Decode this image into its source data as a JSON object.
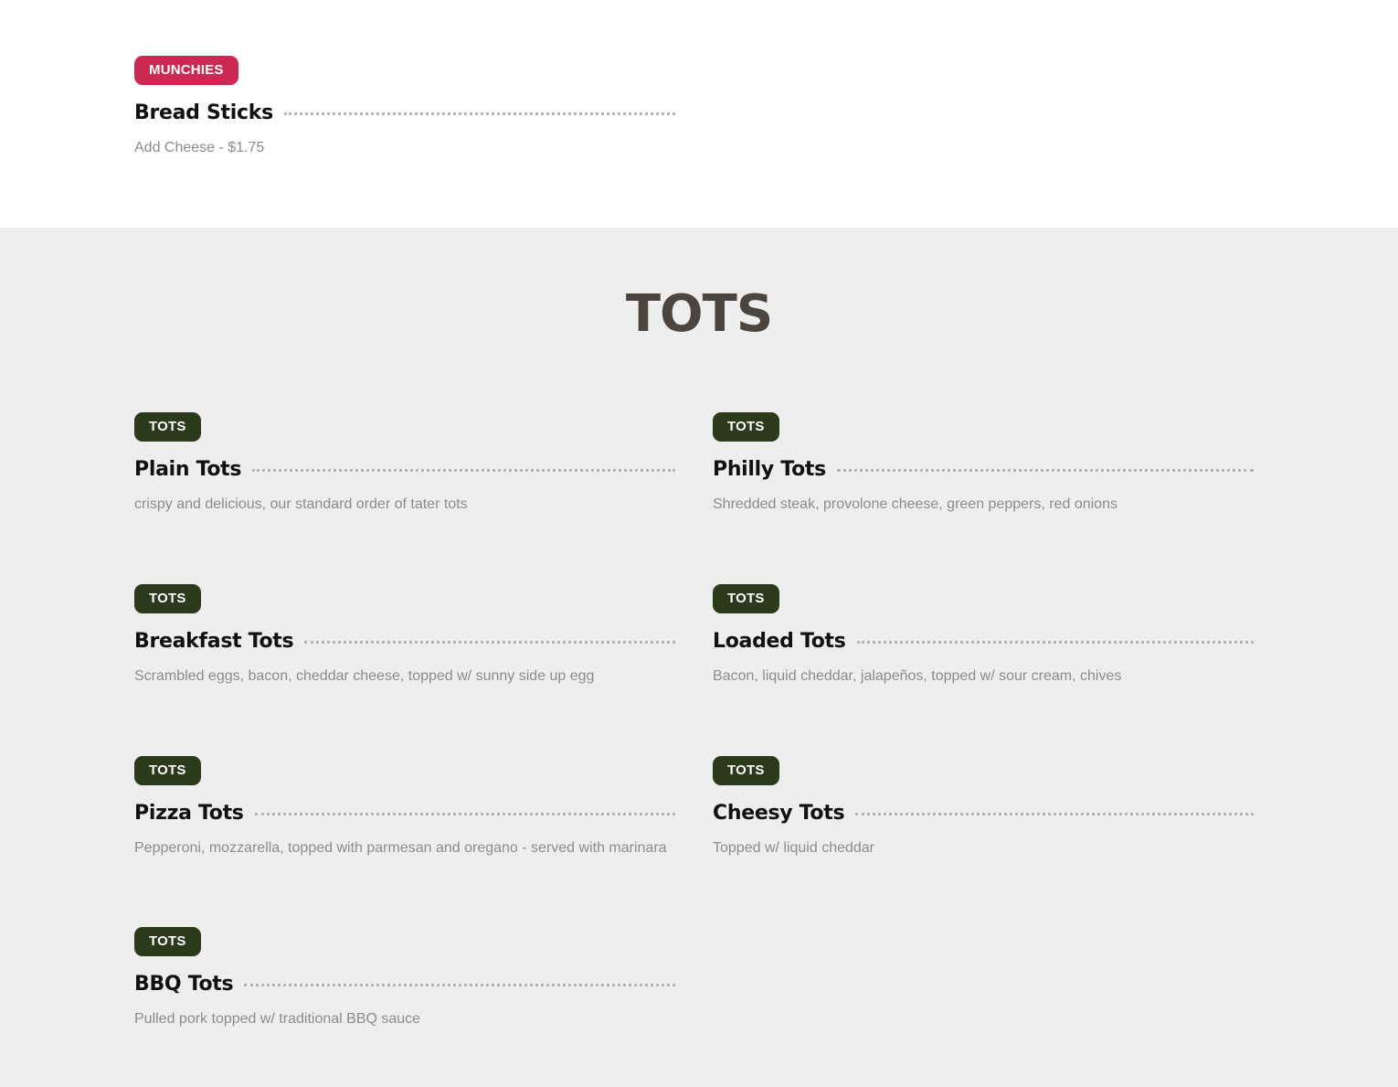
{
  "munchies": {
    "badge": "MUNCHIES",
    "title": "Bread Sticks",
    "desc": "Add Cheese - $1.75"
  },
  "tots": {
    "heading": "TOTS",
    "items": [
      {
        "badge": "TOTS",
        "title": "Plain Tots",
        "desc": "crispy and delicious, our standard order of tater tots"
      },
      {
        "badge": "TOTS",
        "title": "Philly Tots",
        "desc": "Shredded steak, provolone cheese, green peppers, red onions"
      },
      {
        "badge": "TOTS",
        "title": "Breakfast Tots",
        "desc": "Scrambled eggs, bacon, cheddar cheese, topped w/ sunny side up egg"
      },
      {
        "badge": "TOTS",
        "title": "Loaded Tots",
        "desc": "Bacon, liquid cheddar, jalapeños, topped w/ sour cream, chives"
      },
      {
        "badge": "TOTS",
        "title": "Pizza Tots",
        "desc": "Pepperoni, mozzarella, topped with parmesan and oregano - served with marinara"
      },
      {
        "badge": "TOTS",
        "title": "Cheesy Tots",
        "desc": "Topped w/ liquid cheddar"
      },
      {
        "badge": "TOTS",
        "title": "BBQ Tots",
        "desc": "Pulled pork topped w/ traditional BBQ sauce"
      }
    ]
  },
  "colors": {
    "munchies_badge": "#cc2952",
    "tots_badge": "#2b3a1b",
    "gray_section": "#eeeeee",
    "heading": "#4b4540"
  }
}
